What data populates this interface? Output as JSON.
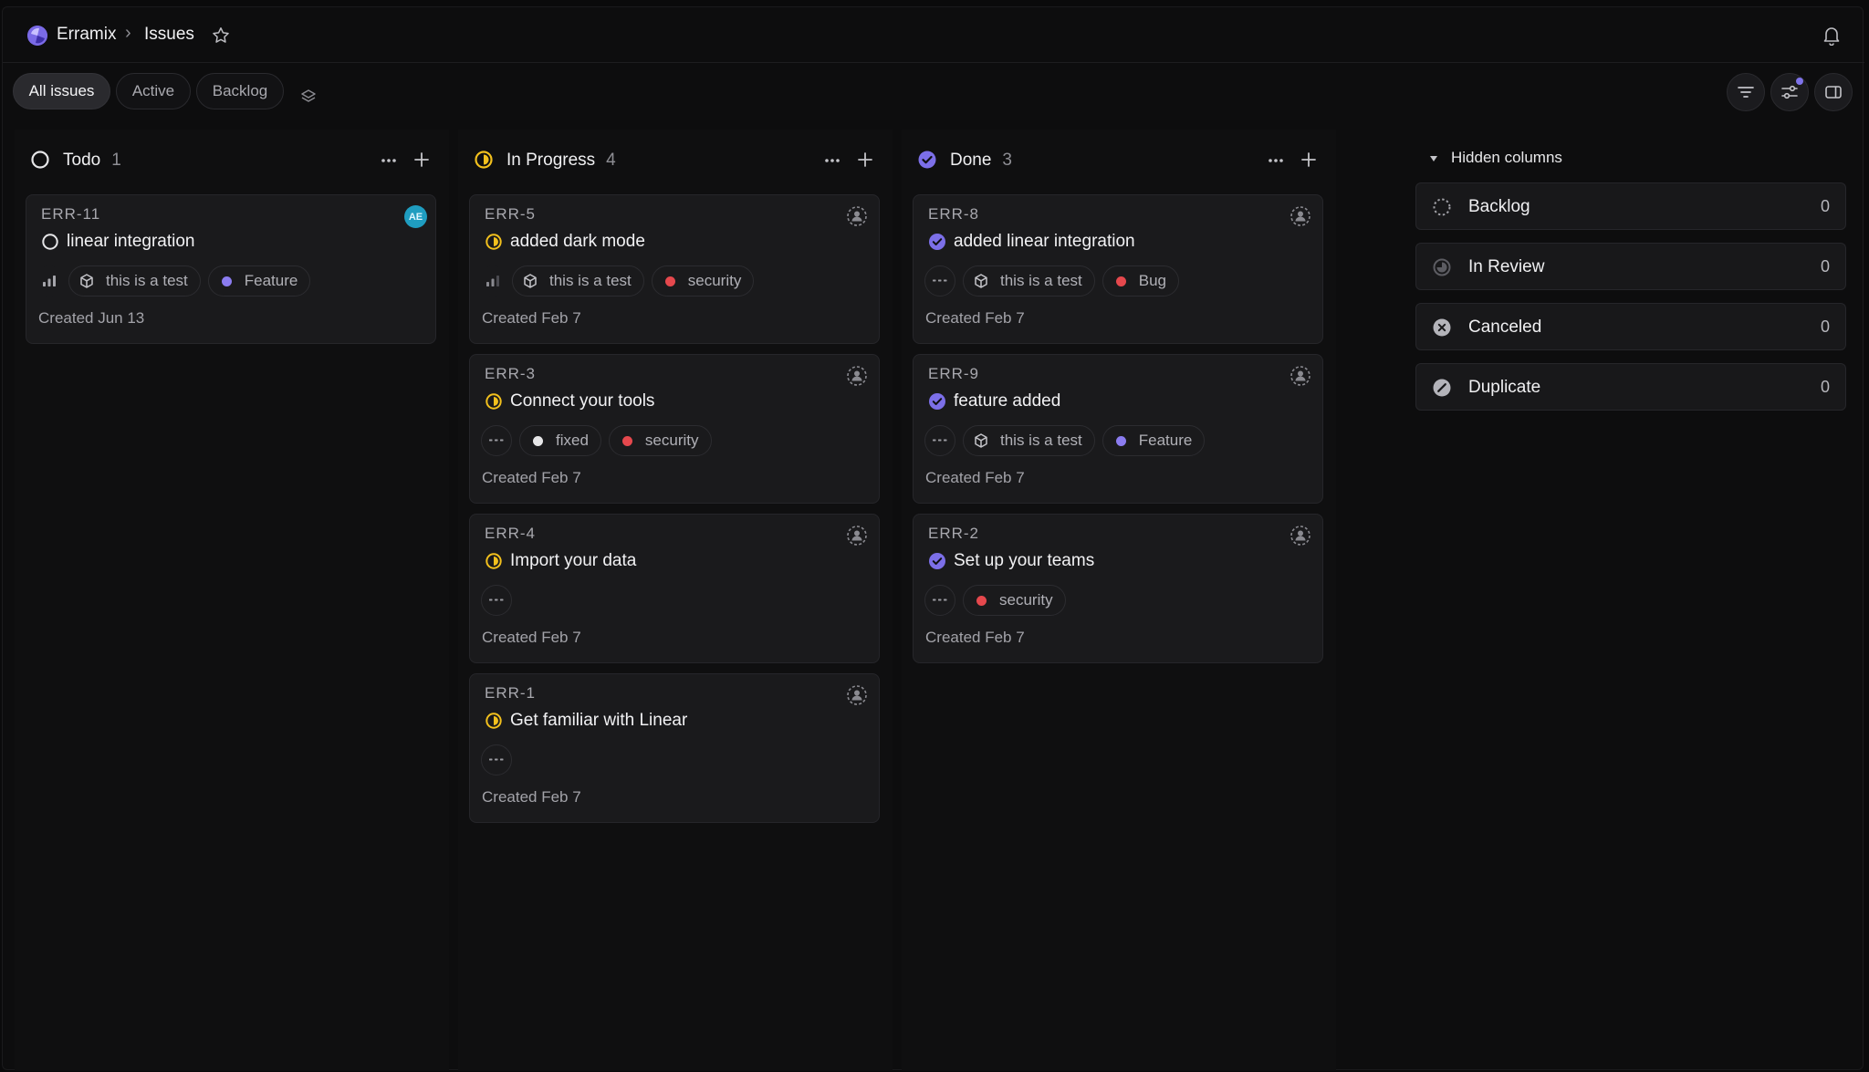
{
  "breadcrumb": {
    "workspace": "Erramix",
    "separator": "›",
    "page": "Issues"
  },
  "colors": {
    "accent": "#7a6ae6",
    "todo": "#e6e6e8",
    "in_progress": "#f2c01d",
    "done": "#7c6fe8",
    "red": "#e5484d",
    "purple_dot": "#8b7cf0",
    "white_dot": "#e6e6e8"
  },
  "view_tabs": [
    {
      "label": "All issues",
      "active": true
    },
    {
      "label": "Active",
      "active": false
    },
    {
      "label": "Backlog",
      "active": false
    }
  ],
  "columns": [
    {
      "title": "Todo",
      "count": "1",
      "status": "todo",
      "cards": [
        {
          "id": "ERR-11",
          "title": "linear integration",
          "assignee": "AE",
          "chips": [
            {
              "kind": "priority-icon"
            },
            {
              "kind": "project",
              "label": "this is a test"
            },
            {
              "kind": "label",
              "label": "Feature",
              "color": "purple"
            }
          ],
          "created": "Created Jun 13"
        }
      ]
    },
    {
      "title": "In Progress",
      "count": "4",
      "status": "in_progress",
      "cards": [
        {
          "id": "ERR-5",
          "title": "added dark mode",
          "chips": [
            {
              "kind": "priority-icon"
            },
            {
              "kind": "project",
              "label": "this is a test"
            },
            {
              "kind": "label",
              "label": "security",
              "color": "red"
            }
          ],
          "created": "Created Feb 7"
        },
        {
          "id": "ERR-3",
          "title": "Connect your tools",
          "chips": [
            {
              "kind": "no-priority-icon"
            },
            {
              "kind": "label",
              "label": "fixed",
              "color": "white"
            },
            {
              "kind": "label",
              "label": "security",
              "color": "red"
            }
          ],
          "created": "Created Feb 7"
        },
        {
          "id": "ERR-4",
          "title": "Import your data",
          "chips": [
            {
              "kind": "no-priority-icon"
            }
          ],
          "created": "Created Feb 7"
        },
        {
          "id": "ERR-1",
          "title": "Get familiar with Linear",
          "chips": [
            {
              "kind": "no-priority-icon"
            }
          ],
          "created": "Created Feb 7"
        }
      ]
    },
    {
      "title": "Done",
      "count": "3",
      "status": "done",
      "cards": [
        {
          "id": "ERR-8",
          "title": "added linear integration",
          "chips": [
            {
              "kind": "no-priority-plain"
            },
            {
              "kind": "project",
              "label": "this is a test"
            },
            {
              "kind": "label",
              "label": "Bug",
              "color": "red"
            }
          ],
          "created": "Created Feb 7"
        },
        {
          "id": "ERR-9",
          "title": "feature added",
          "chips": [
            {
              "kind": "no-priority-plain"
            },
            {
              "kind": "project",
              "label": "this is a test"
            },
            {
              "kind": "label",
              "label": "Feature",
              "color": "purple"
            }
          ],
          "created": "Created Feb 7"
        },
        {
          "id": "ERR-2",
          "title": "Set up your teams",
          "chips": [
            {
              "kind": "no-priority-plain"
            },
            {
              "kind": "label",
              "label": "security",
              "color": "red"
            }
          ],
          "created": "Created Feb 7"
        }
      ]
    }
  ],
  "hidden_columns": {
    "title": "Hidden columns",
    "items": [
      {
        "label": "Backlog",
        "count": "0",
        "icon": "backlog-icon"
      },
      {
        "label": "In Review",
        "count": "0",
        "icon": "in-review-icon"
      },
      {
        "label": "Canceled",
        "count": "0",
        "icon": "canceled-icon"
      },
      {
        "label": "Duplicate",
        "count": "0",
        "icon": "duplicate-icon"
      }
    ]
  }
}
